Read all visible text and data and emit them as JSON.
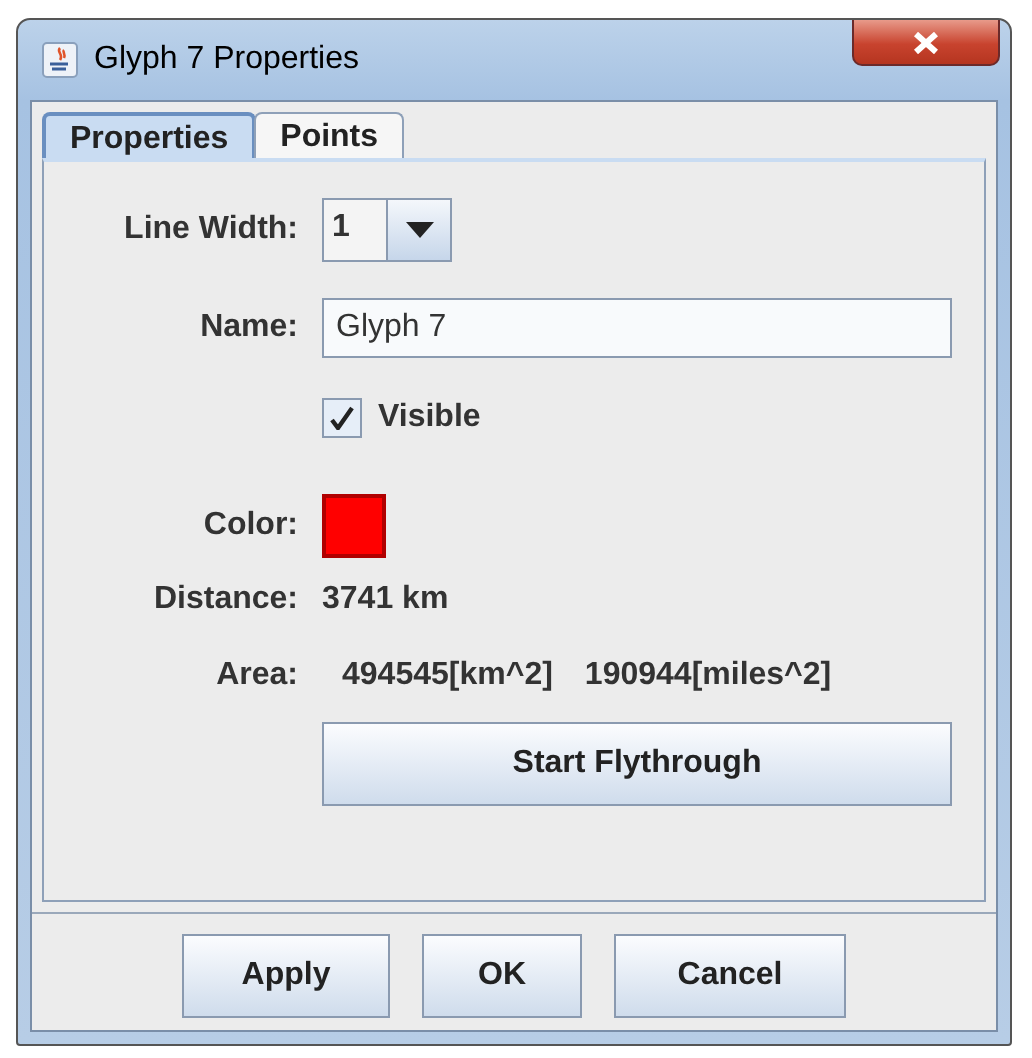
{
  "window": {
    "title": "Glyph 7 Properties"
  },
  "tabs": [
    {
      "label": "Properties",
      "selected": true
    },
    {
      "label": "Points",
      "selected": false
    }
  ],
  "properties": {
    "line_width": {
      "label": "Line Width:",
      "value": "1"
    },
    "name": {
      "label": "Name:",
      "value": "Glyph 7"
    },
    "visible": {
      "label": "Visible",
      "checked": true
    },
    "color": {
      "label": "Color:",
      "color": "#ff0000"
    },
    "distance": {
      "label": "Distance:",
      "value": "3741 km"
    },
    "area": {
      "label": "Area:",
      "values": [
        "494545[km^2]",
        "190944[miles^2]"
      ]
    },
    "flythrough_button": "Start Flythrough"
  },
  "buttons": [
    "Apply",
    "OK",
    "Cancel"
  ]
}
